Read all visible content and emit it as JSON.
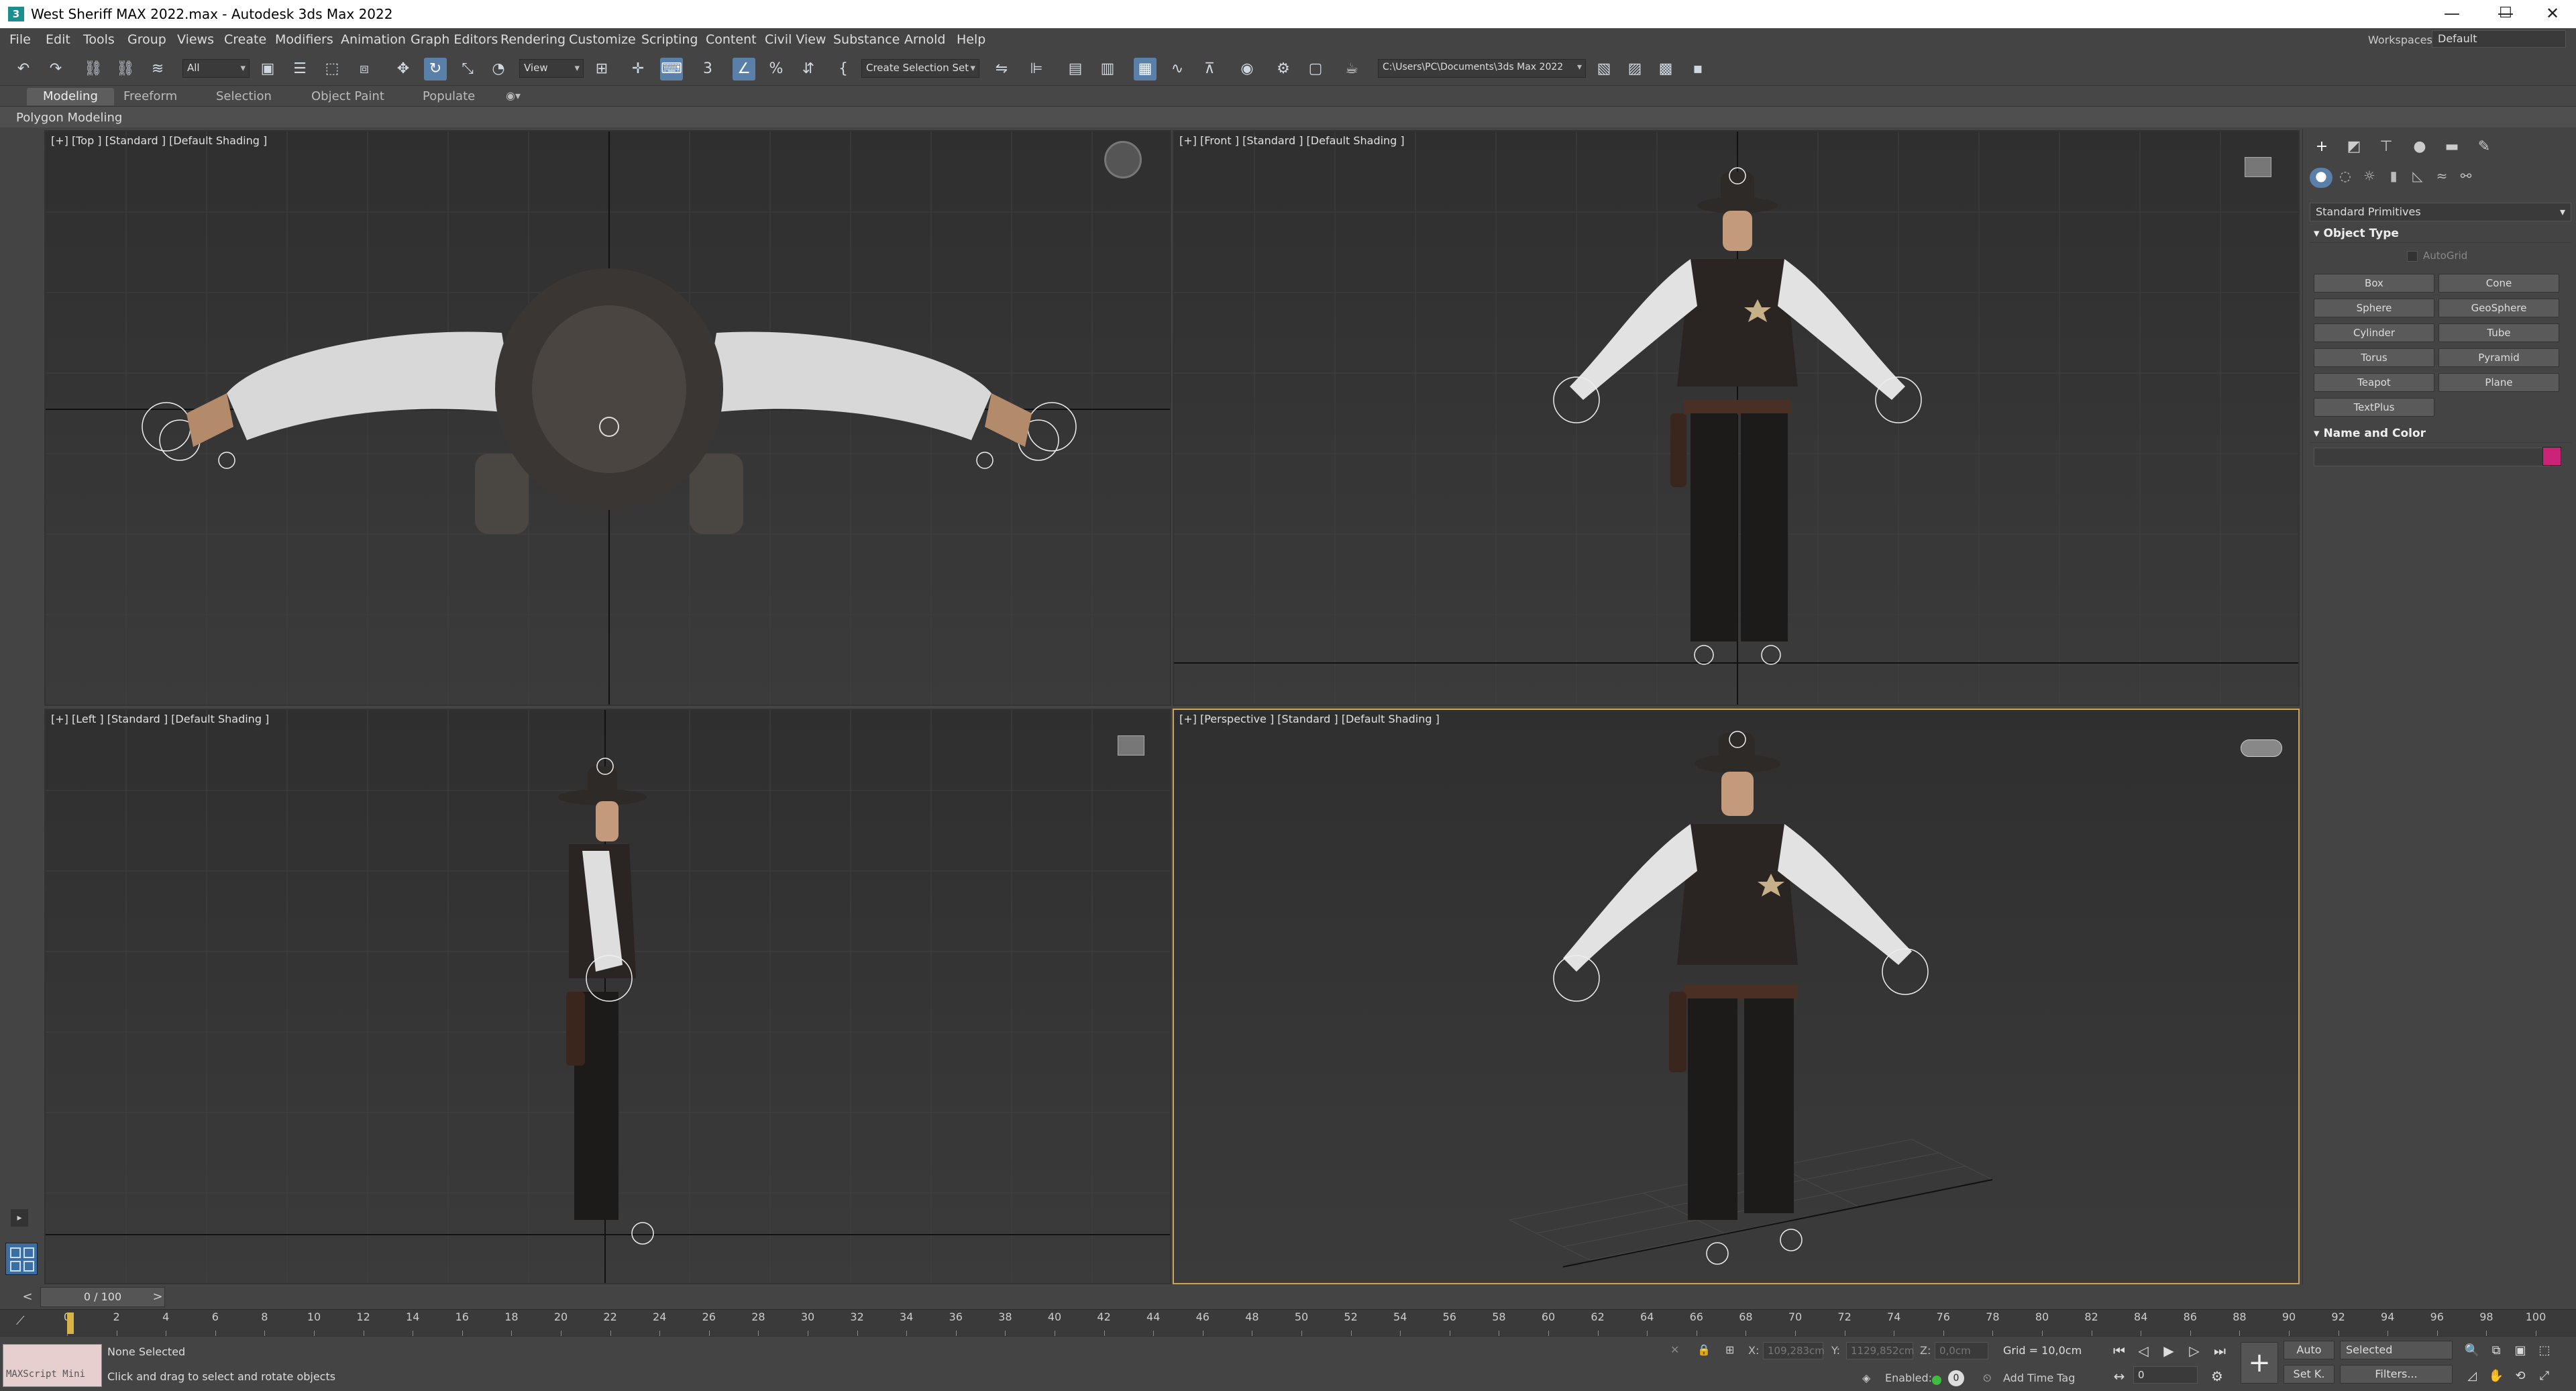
{
  "app": {
    "title": "West Sheriff MAX 2022.max - Autodesk 3ds Max 2022",
    "icon_letter": "3",
    "window_controls": {
      "minimize": "—",
      "maximize": "☐",
      "close": "✕"
    }
  },
  "menu": {
    "items": [
      "File",
      "Edit",
      "Tools",
      "Group",
      "Views",
      "Create",
      "Modifiers",
      "Animation",
      "Graph Editors",
      "Rendering",
      "Customize",
      "Scripting",
      "Content",
      "Civil View",
      "Substance",
      "Arnold",
      "Help"
    ],
    "workspaces_label": "Workspaces:",
    "workspaces_value": "Default"
  },
  "toolbar": {
    "filter_value": "All",
    "refcoord_value": "View",
    "selection_set": "Create Selection Set",
    "project_path": "C:\\Users\\PC\\Documents\\3ds Max 2022"
  },
  "ribbon": {
    "tabs": [
      "Modeling",
      "Freeform",
      "Selection",
      "Object Paint",
      "Populate"
    ],
    "active_tab": "Modeling",
    "sub": "Polygon Modeling"
  },
  "viewports": {
    "top": "[+] [Top ] [Standard ] [Default Shading ]",
    "front": "[+] [Front ] [Standard ] [Default Shading ]",
    "left": "[+] [Left ] [Standard ] [Default Shading ]",
    "perspective": "[+] [Perspective ] [Standard ] [Default Shading ]"
  },
  "command_panel": {
    "category": "Standard Primitives",
    "object_type_title": "Object Type",
    "autogrid": "AutoGrid",
    "buttons": [
      "Box",
      "Cone",
      "Sphere",
      "GeoSphere",
      "Cylinder",
      "Tube",
      "Torus",
      "Pyramid",
      "Teapot",
      "Plane",
      "TextPlus"
    ],
    "name_color_title": "Name and Color",
    "object_color": "#cc2277"
  },
  "timeline": {
    "slider": "0 / 100",
    "ticks": [
      "0",
      "2",
      "4",
      "6",
      "8",
      "10",
      "12",
      "14",
      "16",
      "18",
      "20",
      "22",
      "24",
      "26",
      "28",
      "30",
      "32",
      "34",
      "36",
      "38",
      "40",
      "42",
      "44",
      "46",
      "48",
      "50",
      "52",
      "54",
      "56",
      "58",
      "60",
      "62",
      "64",
      "66",
      "68",
      "70",
      "72",
      "74",
      "76",
      "78",
      "80",
      "82",
      "84",
      "86",
      "88",
      "90",
      "92",
      "94",
      "96",
      "98",
      "100"
    ]
  },
  "status": {
    "maxscript": "MAXScript Mini",
    "line1": "None Selected",
    "line2": "Click and drag to select and rotate objects",
    "x_label": "X:",
    "x_value": "109,283cm",
    "y_label": "Y:",
    "y_value": "1129,852cm",
    "z_label": "Z:",
    "z_value": "0,0cm",
    "grid": "Grid = 10,0cm",
    "enabled_label": "Enabled:",
    "enabled_value": "0",
    "add_time_tag": "Add Time Tag",
    "auto": "Auto",
    "selected": "Selected",
    "set_k": "Set K.",
    "filters": "Filters...",
    "frame": "0"
  }
}
